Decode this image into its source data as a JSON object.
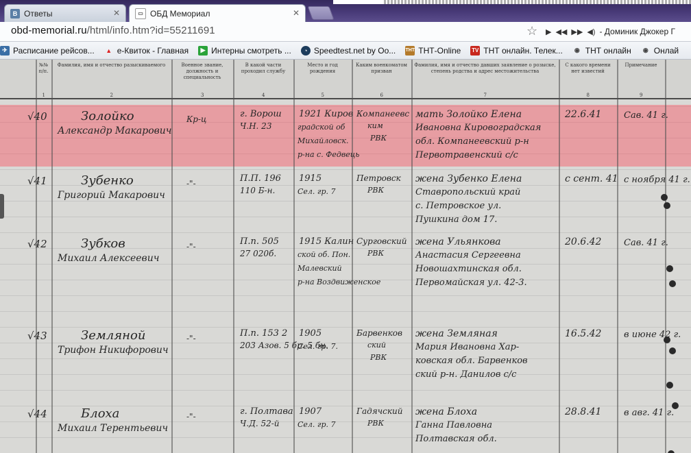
{
  "browser": {
    "tabs": [
      {
        "label": "Ответы",
        "icon": "vk-icon"
      },
      {
        "label": "ОБД Мемориал",
        "icon": "obd-icon"
      }
    ],
    "url": {
      "host": "obd-memorial.ru",
      "path": "/html/info.htm?id=55211691"
    },
    "media": {
      "now_playing": "- Доминик Джокер Г"
    },
    "bookmarks": [
      {
        "label": "Расписание рейсов...",
        "icon": "airplane-icon"
      },
      {
        "label": "e-Квиток - Главная",
        "icon": "ticket-icon"
      },
      {
        "label": "Интерны смотреть ...",
        "icon": "play-icon"
      },
      {
        "label": "Speedtest.net by Oo...",
        "icon": "speedtest-icon"
      },
      {
        "label": "ТНТ-Online",
        "icon": "tnt-icon"
      },
      {
        "label": "ТНТ онлайн. Телек...",
        "icon": "tv-icon"
      },
      {
        "label": "ТНТ онлайн",
        "icon": "globe-icon"
      },
      {
        "label": "Онлай",
        "icon": "globe-icon"
      }
    ]
  },
  "document": {
    "header_columns": [
      {
        "num": "1",
        "text": "№№ п/п."
      },
      {
        "num": "2",
        "text": "Фамилия, имя и отчество разыскиваемого"
      },
      {
        "num": "3",
        "text": "Военное звание, должность и специальность"
      },
      {
        "num": "4",
        "text": "В какой части проходил службу"
      },
      {
        "num": "5",
        "text": "Место и год рождения"
      },
      {
        "num": "6",
        "text": "Каким военкоматом призван"
      },
      {
        "num": "7",
        "text": "Фамилия, имя и отчество давших заявление о розыске, степень родства и адрес местожительства"
      },
      {
        "num": "8",
        "text": "С какого времени нет известий"
      },
      {
        "num": "9",
        "text": "Примечание"
      }
    ],
    "rows": [
      {
        "num": "40",
        "name1": "Золойко",
        "name2": "Александр Макарович",
        "rank": "Кр-ц",
        "unit1": "г. Ворош",
        "unit2": "Ч.Н. 23",
        "birth1": "1921 Киров",
        "birth2": "градской об",
        "birth3": "Михайловск.",
        "birth4": "р-на с. Федвець",
        "mil1": "Компанеевс",
        "mil2": "ким",
        "mil3": "РВК",
        "rel1": "мать Золойко Елена",
        "rel2": "Ивановна Кировоградская",
        "rel3": "обл. Компанеевский р-н",
        "rel4": "Первотравенский с/с",
        "date": "22.6.41",
        "note": "Сав. 41 г."
      },
      {
        "num": "41",
        "name1": "Зубенко",
        "name2": "Григорий Макарович",
        "rank": "-\"-",
        "unit1": "П.П. 196",
        "unit2": "110 Б-н.",
        "birth1": "1915",
        "birth2": "Сел. гр. 7",
        "birth3": "",
        "birth4": "",
        "mil1": "Петровск",
        "mil2": "РВК",
        "mil3": "",
        "rel1": "жена Зубенко Елена",
        "rel2": "Ставропольский край",
        "rel3": "с. Петровское ул.",
        "rel4": "Пушкина дом 17.",
        "date": "с сент. 41",
        "note": "с ноября 41 г."
      },
      {
        "num": "42",
        "name1": "Зубков",
        "name2": "Михаил Алексеевич",
        "rank": "-\"-",
        "unit1": "П.п. 505",
        "unit2": "27 020б.",
        "birth1": "1915 Калин",
        "birth2": "ской об. Пон.",
        "birth3": "Малевский",
        "birth4": "р-на Воздвиженское",
        "mil1": "Сурговский",
        "mil2": "РВК",
        "mil3": "",
        "rel1": "жена Ульянкова",
        "rel2": "Анастасия Сергеевна",
        "rel3": "Новошахтинская обл.",
        "rel4": "Первомайская ул. 42-3.",
        "date": "20.6.42",
        "note": "Сав. 41 г."
      },
      {
        "num": "43",
        "name1": "Земляной",
        "name2": "Трифон Никифорович",
        "rank": "-\"-",
        "unit1": "П.п. 153 2",
        "unit2": "203 Азов. 5 бр. 5 бн.",
        "birth1": "1905",
        "birth2": "Сел. гр. 7.",
        "birth3": "",
        "birth4": "",
        "mil1": "Барвенков",
        "mil2": "ский",
        "mil3": "РВК",
        "rel1": "жена Земляная",
        "rel2": "Мария Ивановна Хар-",
        "rel3": "ковская обл. Барвенков",
        "rel4": "ский р-н. Данилов с/с",
        "date": "16.5.42",
        "note": "в июне 42 г."
      },
      {
        "num": "44",
        "name1": "Блоха",
        "name2": "Михаил Терентьевич",
        "rank": "-\"-",
        "unit1": "г. Полтава",
        "unit2": "Ч.Д. 52-й",
        "birth1": "1907",
        "birth2": "Сел. гр. 7",
        "birth3": "",
        "birth4": "",
        "mil1": "Гадячский",
        "mil2": "РВК",
        "mil3": "",
        "rel1": "жена Блоха",
        "rel2": "Ганна Павловна",
        "rel3": "Полтавская обл.",
        "rel4": "",
        "date": "28.8.41",
        "note": "в авг. 41 г."
      }
    ]
  }
}
